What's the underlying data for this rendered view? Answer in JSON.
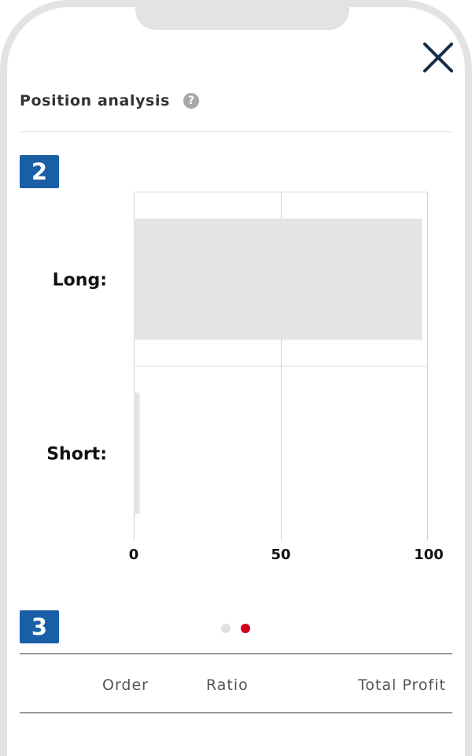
{
  "panel": {
    "title": "Position analysis",
    "help_glyph": "?",
    "close_icon": "close-icon",
    "help_icon": "question-circle-icon"
  },
  "steps": {
    "chart_step": "2",
    "table_step": "3"
  },
  "colors": {
    "badge": "#1a5ea6",
    "bar": "#e4e4e4",
    "pager_active": "#d0021b",
    "pager_inactive": "#e0e0e0",
    "close_icon": "#142c44"
  },
  "chart_data": {
    "type": "bar",
    "orientation": "horizontal",
    "title": "",
    "xlabel": "",
    "ylabel": "",
    "categories": [
      "Long:",
      "Short:"
    ],
    "values": [
      98,
      2
    ],
    "xlim": [
      0,
      100
    ],
    "xticks": [
      0,
      50,
      100
    ],
    "grid": true,
    "legend": "none"
  },
  "pager": {
    "count": 2,
    "active_index": 1
  },
  "table": {
    "columns": [
      "Order",
      "Ratio",
      "Total Profit"
    ]
  }
}
